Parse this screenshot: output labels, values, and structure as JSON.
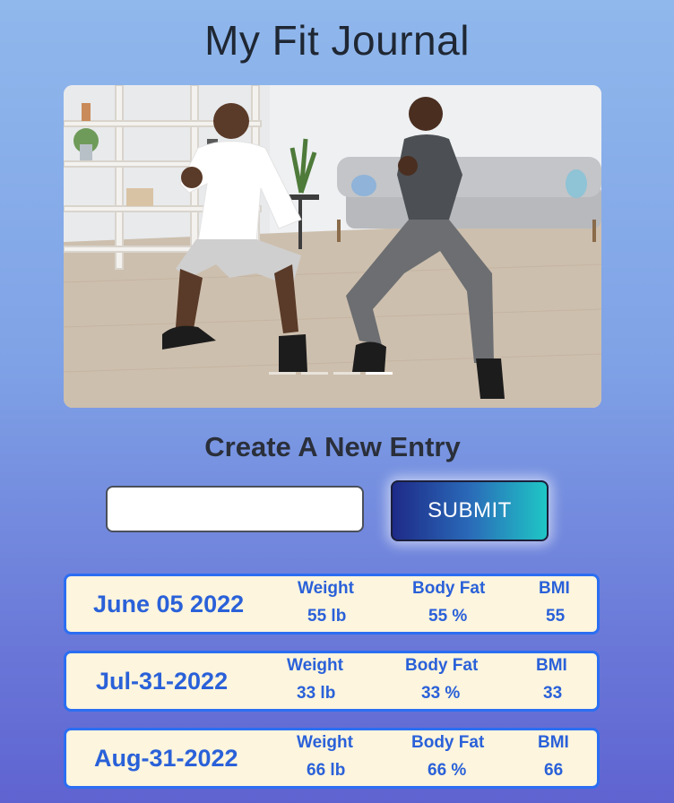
{
  "app": {
    "title": "My Fit Journal"
  },
  "hero": {
    "image_icon": "couple-doing-squats-photo",
    "indicator_count": 4,
    "active_indicator": 3
  },
  "form": {
    "heading": "Create A New Entry",
    "input_value": "",
    "input_placeholder": "",
    "submit_label": "SUBMIT"
  },
  "entries": [
    {
      "date": "June 05 2022",
      "weight_label": "Weight",
      "weight_value": "55 lb",
      "bodyfat_label": "Body Fat",
      "bodyfat_value": "55 %",
      "bmi_label": "BMI",
      "bmi_value": "55"
    },
    {
      "date": "Jul-31-2022",
      "weight_label": "Weight",
      "weight_value": "33 lb",
      "bodyfat_label": "Body Fat",
      "bodyfat_value": "33 %",
      "bmi_label": "BMI",
      "bmi_value": "33"
    },
    {
      "date": "Aug-31-2022",
      "weight_label": "Weight",
      "weight_value": "66 lb",
      "bodyfat_label": "Body Fat",
      "bodyfat_value": "66 %",
      "bmi_label": "BMI",
      "bmi_value": "66"
    }
  ],
  "colors": {
    "card_border": "#2b6ef2",
    "card_background": "#fdf5dd",
    "card_text": "#2a61d9",
    "submit_gradient_start": "#1e2a88",
    "submit_gradient_end": "#1fc6c6"
  }
}
